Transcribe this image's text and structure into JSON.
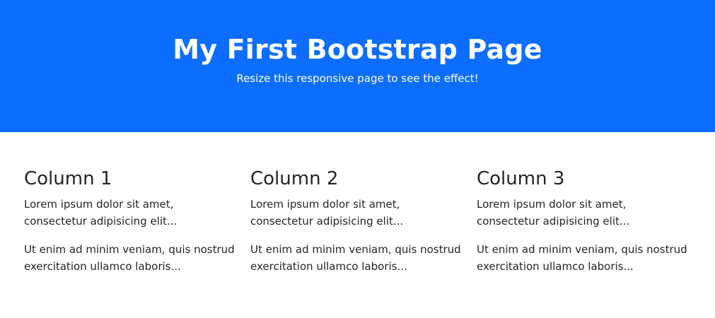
{
  "hero": {
    "title": "My First Bootstrap Page",
    "subtitle": "Resize this responsive page to see the effect!",
    "background_color": "#0d6efd"
  },
  "columns": [
    {
      "heading": "Column 1",
      "paragraphs": [
        "Lorem ipsum dolor sit amet, consectetur adipisicing elit...",
        "Ut enim ad minim veniam, quis nostrud exercitation ullamco laboris..."
      ]
    },
    {
      "heading": "Column 2",
      "paragraphs": [
        "Lorem ipsum dolor sit amet, consectetur adipisicing elit...",
        "Ut enim ad minim veniam, quis nostrud exercitation ullamco laboris..."
      ]
    },
    {
      "heading": "Column 3",
      "paragraphs": [
        "Lorem ipsum dolor sit amet, consectetur adipisicing elit...",
        "Ut enim ad minim veniam, quis nostrud exercitation ullamco laboris..."
      ]
    }
  ]
}
